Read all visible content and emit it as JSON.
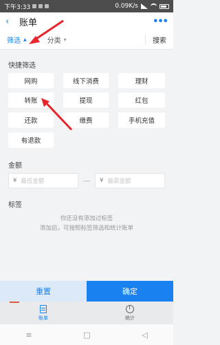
{
  "statusbar": {
    "time": "下午3:33",
    "speed": "0.09K/s",
    "battery": "63"
  },
  "header": {
    "back_glyph": "‹",
    "title": "账单",
    "more_glyph": "•••"
  },
  "filterbar": {
    "filter_label": "筛选",
    "filter_caret": "▲",
    "category_label": "分类",
    "category_caret": "▾",
    "search_label": "搜索"
  },
  "quick": {
    "title": "快捷筛选",
    "chips": [
      "网购",
      "线下消费",
      "理财",
      "转账",
      "提现",
      "红包",
      "还款",
      "缴费",
      "手机充值",
      "有退款"
    ]
  },
  "amount": {
    "title": "金额",
    "currency": "¥",
    "min_placeholder": "最低金额",
    "max_placeholder": "最高金额",
    "separator": "—"
  },
  "tags": {
    "title": "标签",
    "empty_line1": "你还没有添加过标签",
    "empty_line2": "添加后，可按照标签筛选和统计账单"
  },
  "buttons": {
    "reset": "重置",
    "confirm": "确定"
  },
  "tabs": [
    {
      "label": "账单",
      "icon": "bill-icon"
    },
    {
      "label": "统计",
      "icon": "stats-icon"
    }
  ],
  "nav": {
    "menu": "≡",
    "home": "□",
    "back": "◁"
  },
  "colors": {
    "accent": "#1a82f0",
    "annotation": "#e8252a"
  }
}
